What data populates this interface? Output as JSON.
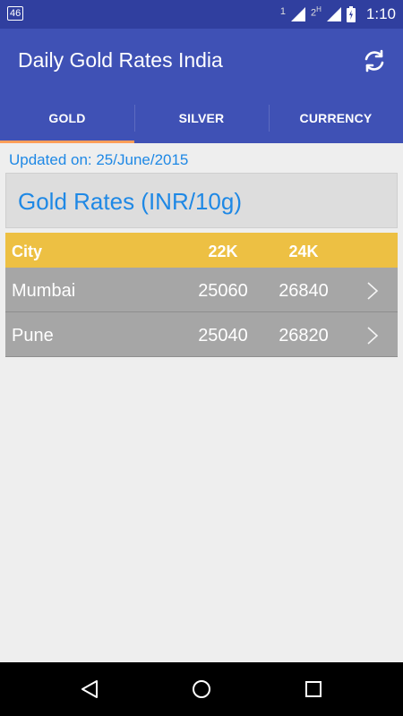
{
  "status_bar": {
    "network": "46",
    "sim1": "1",
    "sim2": "2",
    "sim2_type": "H",
    "time": "1:10"
  },
  "app_bar": {
    "title": "Daily Gold Rates India"
  },
  "tabs": [
    {
      "label": "GOLD",
      "active": true
    },
    {
      "label": "SILVER",
      "active": false
    },
    {
      "label": "CURRENCY",
      "active": false
    }
  ],
  "updated_text": "Updated on: 25/June/2015",
  "section_title": "Gold Rates (INR/10g)",
  "table": {
    "headers": {
      "city": "City",
      "k22": "22K",
      "k24": "24K"
    },
    "rows": [
      {
        "city": "Mumbai",
        "k22": "25060",
        "k24": "26840"
      },
      {
        "city": "Pune",
        "k22": "25040",
        "k24": "26820"
      }
    ]
  },
  "colors": {
    "app_bar": "#3f51b5",
    "status_bar": "#303f9f",
    "tab_indicator": "#ff9e59",
    "header_row": "#edc043",
    "data_row": "#a6a6a6",
    "accent_text": "#1e88e5"
  },
  "icons": [
    "refresh-icon",
    "chevron-right-icon",
    "nav-back-icon",
    "nav-home-icon",
    "nav-recents-icon",
    "signal-icon",
    "battery-icon"
  ]
}
